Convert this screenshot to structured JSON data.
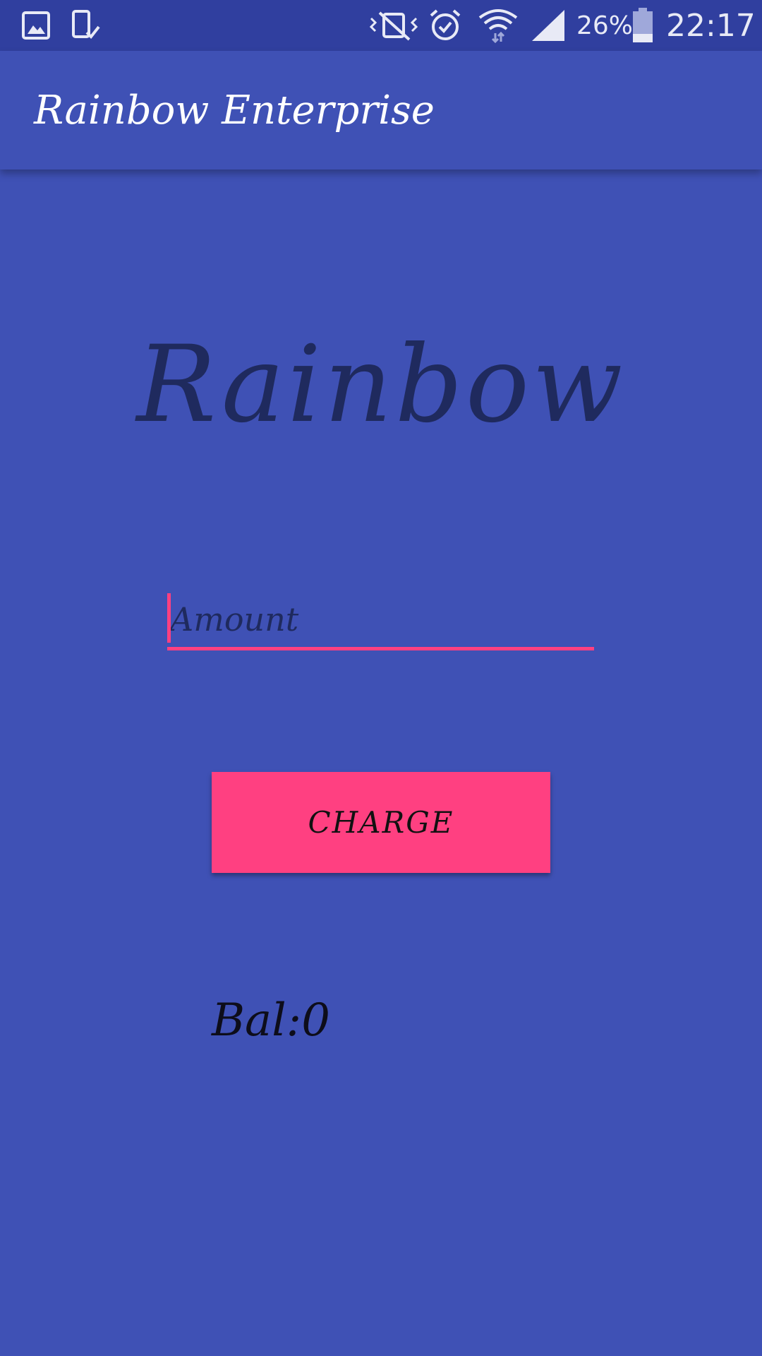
{
  "status_bar": {
    "battery_percent": "26%",
    "time": "22:17",
    "icons": [
      "gallery-icon",
      "device-check-icon",
      "vibrate-silent-icon",
      "alarm-icon",
      "wifi-icon",
      "signal-icon",
      "battery-icon"
    ]
  },
  "app_bar": {
    "title": "Rainbow Enterprise"
  },
  "main": {
    "hero_title": "Rainbow",
    "amount_placeholder": "Amount",
    "amount_value": "",
    "charge_label": "CHARGE",
    "balance_text": "Bal:0"
  },
  "colors": {
    "primary": "#3f51b5",
    "primary_dark": "#303f9f",
    "accent": "#ff4081",
    "hero_text": "#1f2a5e"
  }
}
